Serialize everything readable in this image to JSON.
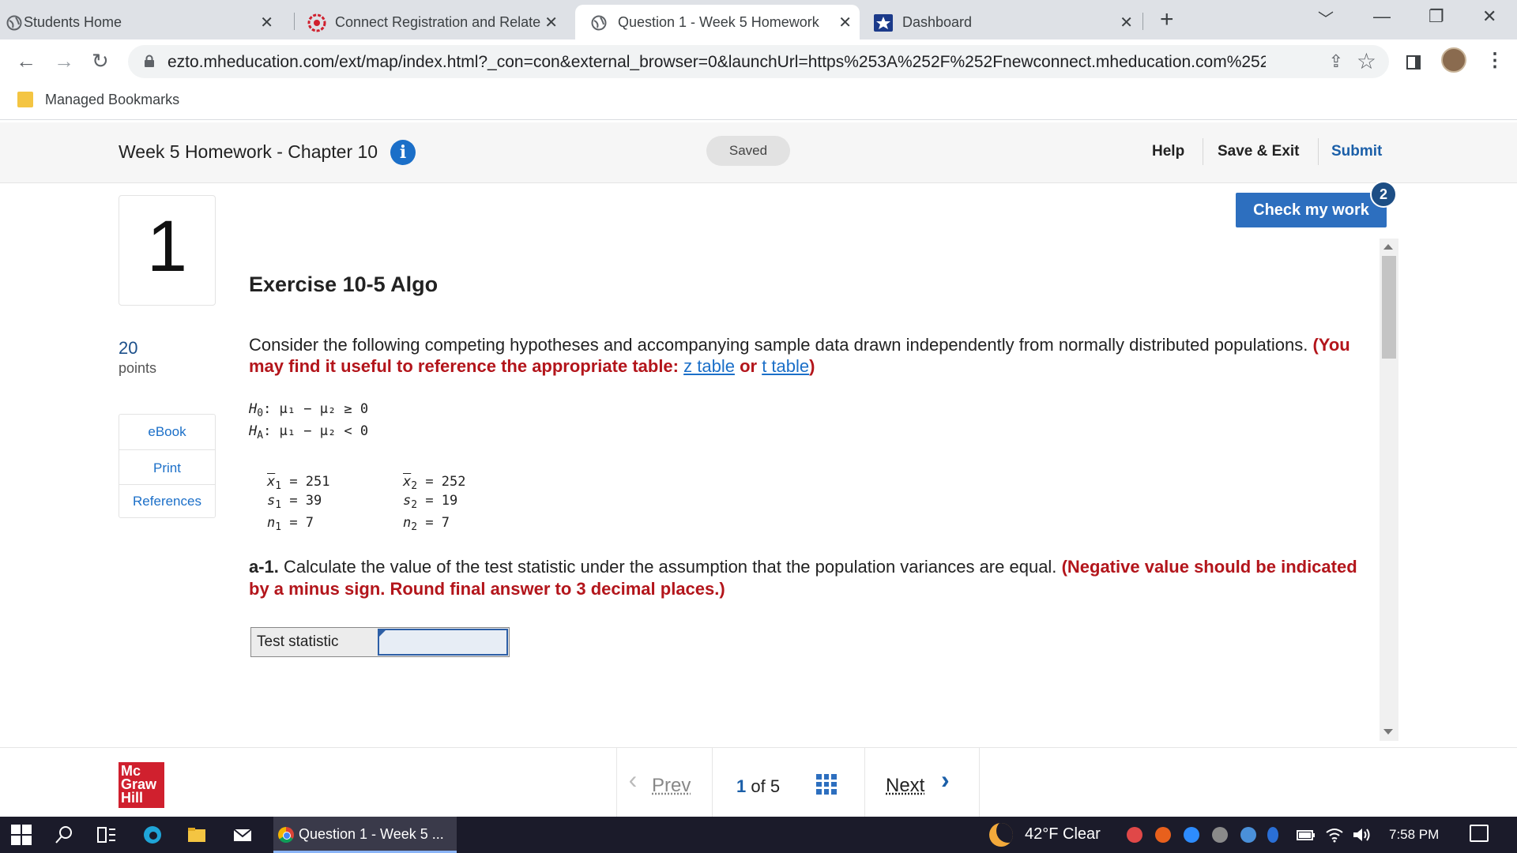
{
  "browser": {
    "tabs": [
      {
        "title": "Students Home",
        "active": false
      },
      {
        "title": "Connect Registration and Related",
        "active": false
      },
      {
        "title": "Question 1 - Week 5 Homework",
        "active": true
      },
      {
        "title": "Dashboard",
        "active": false
      }
    ],
    "url": "ezto.mheducation.com/ext/map/index.html?_con=con&external_browser=0&launchUrl=https%253A%252F%252Fnewconnect.mheducation.com%252F#/...",
    "bookmarks_folder": "Managed Bookmarks"
  },
  "header": {
    "assignment_title": "Week 5 Homework - Chapter 10",
    "info_icon": "i",
    "saved_status": "Saved",
    "help": "Help",
    "save_exit": "Save & Exit",
    "submit": "Submit"
  },
  "question": {
    "number": "1",
    "points_value": "20",
    "points_label": "points",
    "resources": [
      "eBook",
      "Print",
      "References"
    ],
    "check_my_work": "Check my work",
    "check_badge": "2",
    "exercise_title": "Exercise 10-5 Algo",
    "prompt_text": "Consider the following competing hypotheses and accompanying sample data drawn independently from normally distributed populations.",
    "prompt_red_start": "(You may find it useful to reference the appropriate table:",
    "z_table_link": "z table",
    "or_text": "or",
    "t_table_link": "t table",
    "prompt_red_end": ")",
    "hypotheses": {
      "h0": {
        "label": "H",
        "sub": "0",
        "expr": ": μ₁ − μ₂ ≥ 0"
      },
      "ha": {
        "label": "H",
        "sub": "A",
        "expr": ": μ₁ − μ₂ < 0"
      }
    },
    "sample1": {
      "xbar": "251",
      "s": "39",
      "n": "7"
    },
    "sample2": {
      "xbar": "252",
      "s": "19",
      "n": "7"
    },
    "part_label": "a-1.",
    "part_text": "Calculate the value of the test statistic under the assumption that the population variances are equal.",
    "part_instructions": "(Negative value should be indicated by a minus sign. Round final answer to 3 decimal places.)",
    "answer_label": "Test statistic",
    "answer_value": ""
  },
  "footer": {
    "logo_lines": [
      "Mc",
      "Graw",
      "Hill"
    ],
    "prev": "Prev",
    "page_current": "1",
    "page_of": "of",
    "page_total": "5",
    "next": "Next"
  },
  "taskbar": {
    "active_window": "Question 1 - Week 5 ...",
    "weather": "42°F  Clear",
    "time": "7:58 PM"
  },
  "colors": {
    "accent_blue": "#2d6fbf",
    "instruction_red": "#b3151b",
    "brand_red": "#d0202e"
  }
}
